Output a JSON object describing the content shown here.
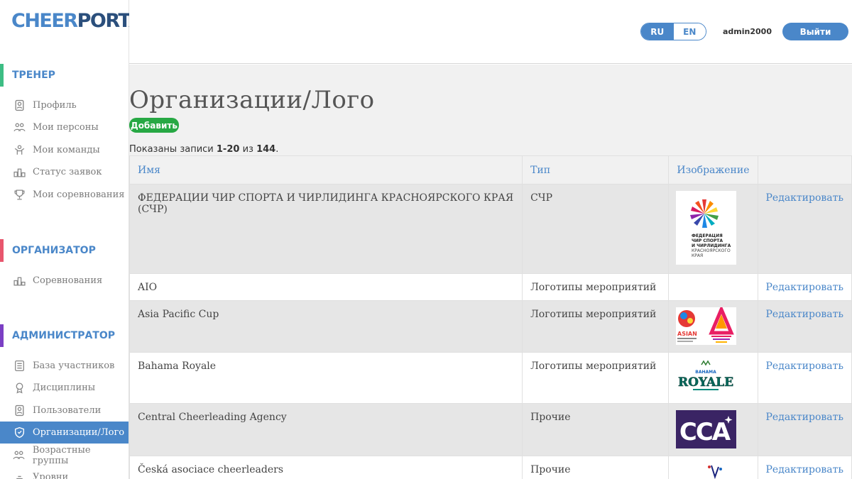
{
  "logo": {
    "part1": "CHEER",
    "part2": "PORTAL"
  },
  "sections": [
    {
      "title": "ТРЕНЕР",
      "color": "#3dbd84"
    },
    {
      "title": "ОРГАНИЗАТОР",
      "color": "#e8566d"
    },
    {
      "title": "АДМИНИСТРАТОР",
      "color": "#7b3fc4"
    }
  ],
  "nav": {
    "trainer": [
      {
        "label": "Профиль",
        "icon": "profile-icon"
      },
      {
        "label": "Мои персоны",
        "icon": "persons-icon"
      },
      {
        "label": "Мои команды",
        "icon": "teams-icon"
      },
      {
        "label": "Статус заявок",
        "icon": "status-icon"
      },
      {
        "label": "Мои соревнования",
        "icon": "trophy-icon"
      }
    ],
    "organizer": [
      {
        "label": "Соревнования",
        "icon": "podium-icon"
      }
    ],
    "admin": [
      {
        "label": "База участников",
        "icon": "database-icon"
      },
      {
        "label": "Дисциплины",
        "icon": "medal-icon"
      },
      {
        "label": "Пользователи",
        "icon": "users-icon"
      },
      {
        "label": "Организации/Лого",
        "icon": "shield-icon",
        "active": true
      },
      {
        "label": "Возрастные группы",
        "icon": "age-groups-icon"
      },
      {
        "label": "Уровни",
        "icon": "levels-icon"
      }
    ]
  },
  "topbar": {
    "lang_ru": "RU",
    "lang_en": "EN",
    "username": "admin2000",
    "logout": "Выйти"
  },
  "page": {
    "title": "Организации/Лого",
    "add_button": "Добавить",
    "summary_prefix": "Показаны записи ",
    "summary_range": "1-20",
    "summary_mid": " из ",
    "summary_total": "144",
    "summary_suffix": "."
  },
  "table": {
    "columns": [
      "Имя",
      "Тип",
      "Изображение",
      ""
    ],
    "edit_label": "Редактировать",
    "rows": [
      {
        "name": "ФЕДЕРАЦИИ ЧИР СПОРТА И ЧИРЛИДИНГА КРАСНОЯРСКОГО КРАЯ (СЧР)",
        "type": "СЧР",
        "image": "fcs-logo"
      },
      {
        "name": "AIO",
        "type": "Логотипы мероприятий",
        "image": ""
      },
      {
        "name": "Asia Pacific Cup",
        "type": "Логотипы мероприятий",
        "image": "asia-pacific-logo"
      },
      {
        "name": "Bahama Royale",
        "type": "Логотипы мероприятий",
        "image": "bahama-logo"
      },
      {
        "name": "Central Cheerleading Agency",
        "type": "Прочие",
        "image": "cca-logo"
      },
      {
        "name": "Česká asociace cheerleaders",
        "type": "Прочие",
        "image": "czech-logo"
      }
    ]
  },
  "logo_text": {
    "fcs": [
      "ФЕДЕРАЦИЯ",
      "ЧИР СПОРТА",
      "И ЧИРЛИДИНГА",
      "КРАСНОЯРСКОГО",
      "КРАЯ"
    ],
    "asian": "ASIAN",
    "bahama_top": "BAHAMA",
    "bahama_main": "ROYALE",
    "cca": "CCA"
  }
}
